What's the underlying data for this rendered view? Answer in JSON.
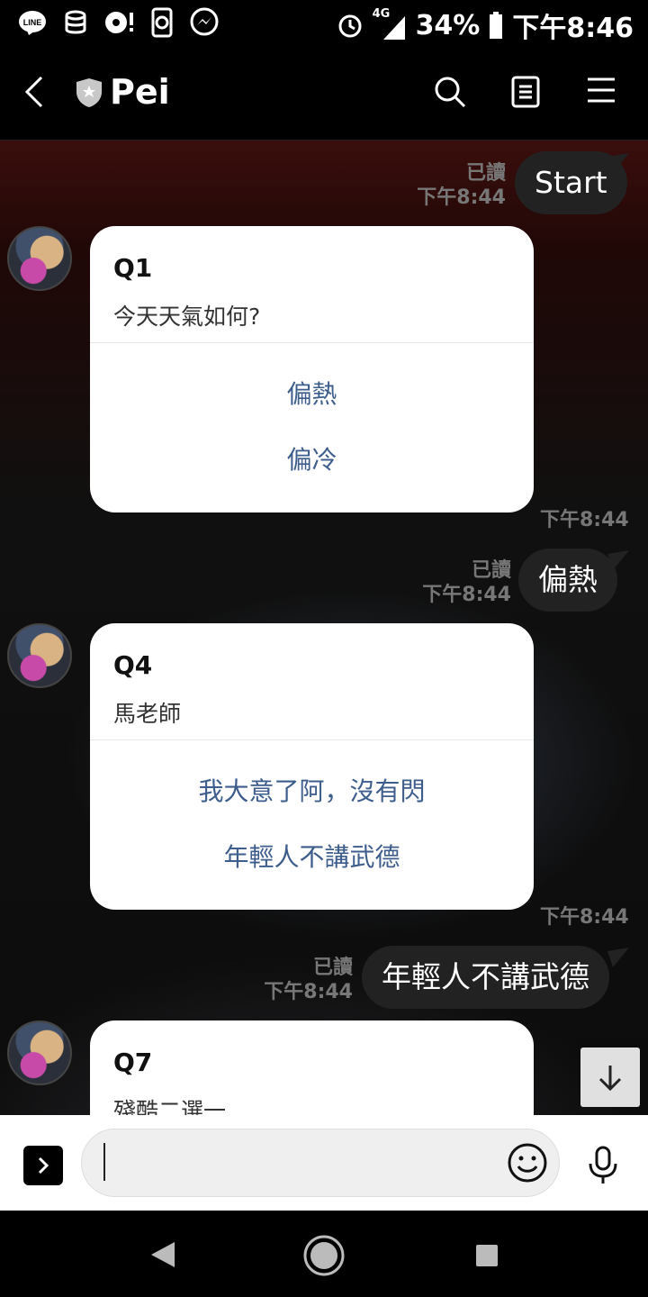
{
  "status_bar": {
    "network": "4G",
    "battery": "34%",
    "time": "下午8:46",
    "notification_icons": [
      "line-icon",
      "database-icon",
      "media-icon",
      "recording-icon",
      "messenger-icon"
    ]
  },
  "header": {
    "title": "Pei"
  },
  "messages": {
    "start": {
      "text": "Start",
      "read": "已讀",
      "time": "下午8:44"
    },
    "q1": {
      "title": "Q1",
      "subtitle": "今天天氣如何?",
      "options": [
        "偏熱",
        "偏冷"
      ],
      "time": "下午8:44"
    },
    "reply1": {
      "text": "偏熱",
      "read": "已讀",
      "time": "下午8:44"
    },
    "q4": {
      "title": "Q4",
      "subtitle": "馬老師",
      "options": [
        "我大意了阿，沒有閃",
        "年輕人不講武德"
      ],
      "time": "下午8:44"
    },
    "reply2": {
      "text": "年輕人不講武德",
      "read": "已讀",
      "time": "下午8:44"
    },
    "q7": {
      "title": "Q7",
      "subtitle": "殘酷二選一"
    }
  },
  "input": {
    "placeholder": ""
  },
  "colors": {
    "option_text": "#3d5d8c",
    "bubble_bg": "#222222",
    "header_bg": "#000000"
  }
}
